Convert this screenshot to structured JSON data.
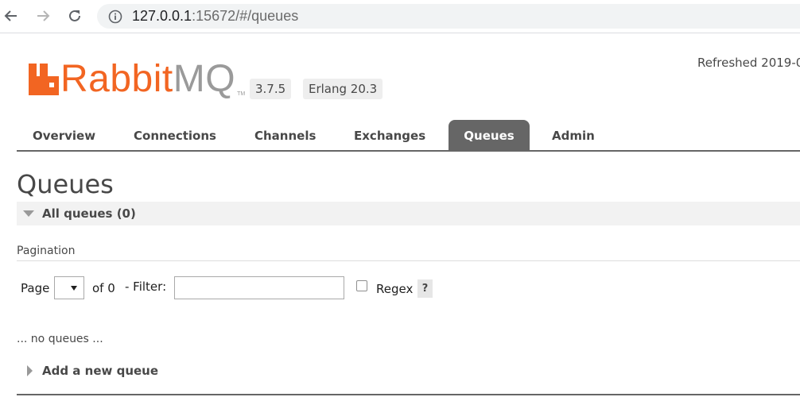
{
  "browser": {
    "url_host": "127.0.0.1",
    "url_rest": ":15672/#/queues",
    "icons": {
      "back": "back-arrow-icon",
      "forward": "forward-arrow-icon",
      "reload": "reload-icon",
      "info": "info-icon"
    }
  },
  "header": {
    "logo_rabbit": "Rabbit",
    "logo_mq": "MQ",
    "logo_tm": "TM",
    "rabbit_version": "3.7.5",
    "erlang_version": "Erlang 20.3",
    "refreshed": "Refreshed 2019-0"
  },
  "colors": {
    "brand_orange": "#f26522",
    "tab_selected": "#666666",
    "text": "#484848"
  },
  "tabs": [
    {
      "label": "Overview",
      "selected": false
    },
    {
      "label": "Connections",
      "selected": false
    },
    {
      "label": "Channels",
      "selected": false
    },
    {
      "label": "Exchanges",
      "selected": false
    },
    {
      "label": "Queues",
      "selected": true
    },
    {
      "label": "Admin",
      "selected": false
    }
  ],
  "main": {
    "title": "Queues",
    "section_label": "All queues (0)",
    "pagination": {
      "heading": "Pagination",
      "page_label": "Page",
      "page_selected": "",
      "of_label": "of 0",
      "filter_label": "- Filter:",
      "filter_value": "",
      "regex_label": "Regex",
      "regex_checked": false,
      "help_label": "?"
    },
    "empty_message": "... no queues ...",
    "add_queue_label": "Add a new queue"
  }
}
